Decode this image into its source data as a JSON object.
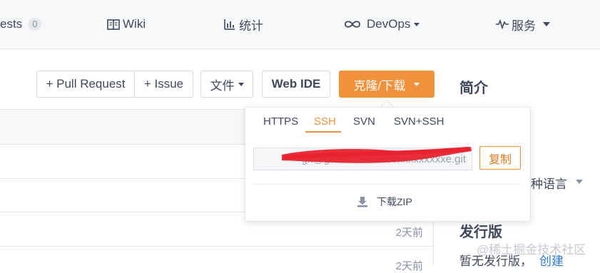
{
  "nav": {
    "pull_requests_label": "ests",
    "pull_requests_count": "0",
    "wiki_label": "Wiki",
    "stats_label": "统计",
    "devops_label": "DevOps",
    "services_label": "服务"
  },
  "toolbar": {
    "pull_request_label": "+ Pull Request",
    "issue_label": "+ Issue",
    "file_label": "文件",
    "web_ide_label": "Web IDE",
    "clone_label": "克隆/下载"
  },
  "sidebar": {
    "intro_title": "简介",
    "language_label": "种语言",
    "release_title": "发行版",
    "release_empty": "暂无发行版，",
    "release_create": "创建"
  },
  "file_rows": [
    {
      "time": ""
    },
    {
      "time": ""
    },
    {
      "time": ""
    },
    {
      "time": "2天前"
    },
    {
      "time": "2天前"
    }
  ],
  "clone_dropdown": {
    "tabs": [
      "HTTPS",
      "SSH",
      "SVN",
      "SVN+SSH"
    ],
    "active_tab": "SSH",
    "url_value": "git@gitee.com:xxxx/xxxxxxxxxe.git",
    "copy_label": "复制",
    "download_zip_label": "下载ZIP"
  },
  "watermark": "@稀土掘金技术社区",
  "colors": {
    "accent": "#f0923b",
    "link": "#2a7bd5",
    "redaction": "#e8232f"
  }
}
